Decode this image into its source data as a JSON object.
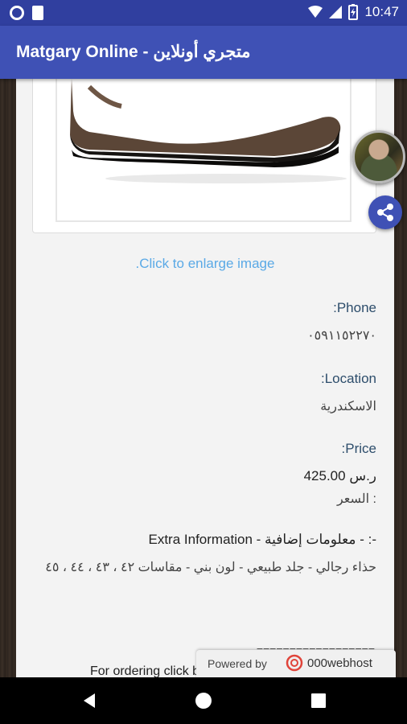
{
  "status": {
    "time": "10:47"
  },
  "app_bar": {
    "title": "Matgary Online - متجري أونلاين"
  },
  "product": {
    "enlarge_link": ".Click to enlarge image",
    "phone_label": ":Phone",
    "phone_value": "٠٥٩١١٥٢٢٧٠",
    "location_label": ":Location",
    "location_value": "الاسكندرية",
    "price_label": ":Price",
    "price_value": "425.00 ر.س",
    "price_caption": "السعر :",
    "extra_title": "Extra Information - معلومات إضافية - :-",
    "extra_text": "حذاء رجالي - جلد طبيعي - لون بني - مقاسات ٤٢ ، ٤٣ ، ٤٤ ، ٤٥",
    "divider": "==================",
    "order_text": "For ordering click below link to send e-mail with"
  },
  "badge": {
    "powered_by": "Powered by",
    "brand": "000webhost"
  },
  "icons": {
    "share": "share-icon",
    "avatar": "profile-avatar",
    "back": "back-icon",
    "home": "home-icon",
    "recents": "recents-icon"
  },
  "colors": {
    "primary": "#3f51b5",
    "primary_dark": "#303f9f",
    "link": "#5aa9e6",
    "label": "#2d4d6b"
  }
}
